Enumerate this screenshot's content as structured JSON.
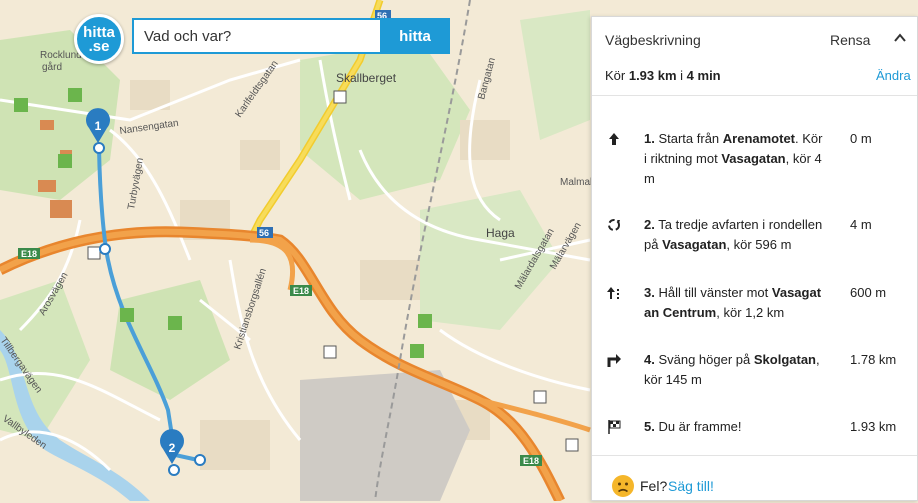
{
  "logo": {
    "line1": "hitta",
    "line2": ".se"
  },
  "search": {
    "placeholder": "Vad och var?",
    "button_label": "hitta"
  },
  "panel": {
    "title": "Vägbeskrivning",
    "clear_label": "Rensa",
    "summary_prefix": "Kör ",
    "summary_distance": "1.93 km",
    "summary_mid": " i ",
    "summary_time": "4 min",
    "change_label": "Ändra",
    "steps": [
      {
        "icon": "arrow-up-icon",
        "num": "1.",
        "t1": " Starta från ",
        "b1": "Arenamotet",
        "t2": ". Kör i riktning mot ",
        "b2": "Vasagatan",
        "t3": ", kör 4 m",
        "distance": "0 m"
      },
      {
        "icon": "roundabout-icon",
        "num": "2.",
        "t1": " Ta tredje avfarten i rondellen på ",
        "b1": "Vasagatan",
        "t2": ", kör 596 m",
        "b2": "",
        "t3": "",
        "distance": "4 m"
      },
      {
        "icon": "keep-left-icon",
        "num": "3.",
        "t1": " Håll till vänster mot ",
        "b1": "Vasagatan Centrum",
        "t2": ", kör 1,2 km",
        "b2": "",
        "t3": "",
        "distance": "600 m"
      },
      {
        "icon": "turn-right-icon",
        "num": "4.",
        "t1": " Sväng höger på ",
        "b1": "Skolgatan",
        "t2": ", kör 145 m",
        "b2": "",
        "t3": "",
        "distance": "1.78 km"
      },
      {
        "icon": "finish-flag-icon",
        "num": "5.",
        "t1": " Du är framme!",
        "b1": "",
        "t2": "",
        "b2": "",
        "t3": "",
        "distance": "1.93 km"
      }
    ],
    "feedback_label": "Fel?",
    "feedback_link": "Säg till!"
  },
  "map": {
    "route_color": "#4a9fd8",
    "markers": [
      {
        "label": "1"
      },
      {
        "label": "2"
      }
    ],
    "road_shields": [
      "E18",
      "E18",
      "E18",
      "56",
      "56"
    ],
    "places": [
      "Skallberget",
      "Haga",
      "Rocklunda gård",
      "Malmaberg"
    ],
    "streets": [
      "Nansengatan",
      "Karlfeldtsgatan",
      "Bangatan",
      "Turbyvägen",
      "Arosvägen",
      "Kristiansborgsallén",
      "Mälarvägen",
      "Mälardalsgatan",
      "Tillbergavägen",
      "Vallbyleden"
    ]
  }
}
